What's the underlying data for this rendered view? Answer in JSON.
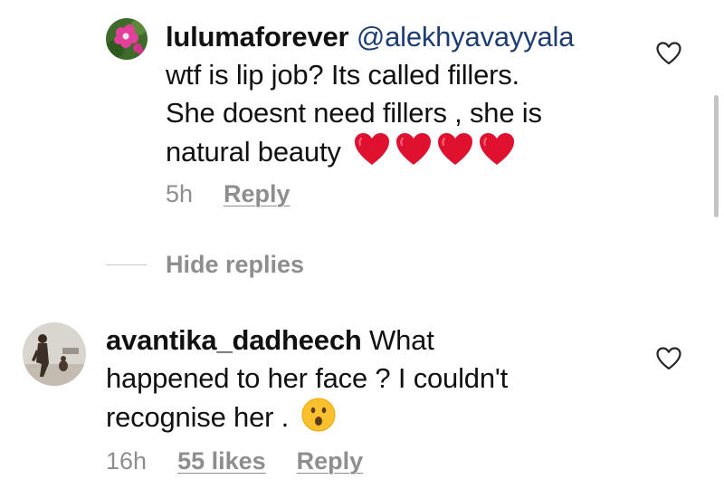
{
  "reply_comment": {
    "username": "lulumaforever",
    "mention": "@alekhyavayyala",
    "line1_tail": "wtf is lip job? Its called fillers.",
    "line2": "She doesnt need fillers , she is",
    "line3": "natural beauty",
    "emoji": [
      "red-heart",
      "red-heart",
      "red-heart",
      "red-heart"
    ],
    "time": "5h",
    "reply_label": "Reply"
  },
  "hide_replies_label": "Hide replies",
  "main_comment": {
    "username": "avantika_dadheech",
    "line1_tail": "What",
    "line2": "happened to her face ? I couldn't",
    "line3": "recognise her .",
    "emoji": "hushed-face",
    "time": "16h",
    "likes": "55 likes",
    "reply_label": "Reply"
  },
  "colors": {
    "meta_gray": "#8e8e8e",
    "mention_blue": "#1e3d73",
    "heart_red": "#e0112f",
    "emoji_yellow": "#fbc02d"
  }
}
